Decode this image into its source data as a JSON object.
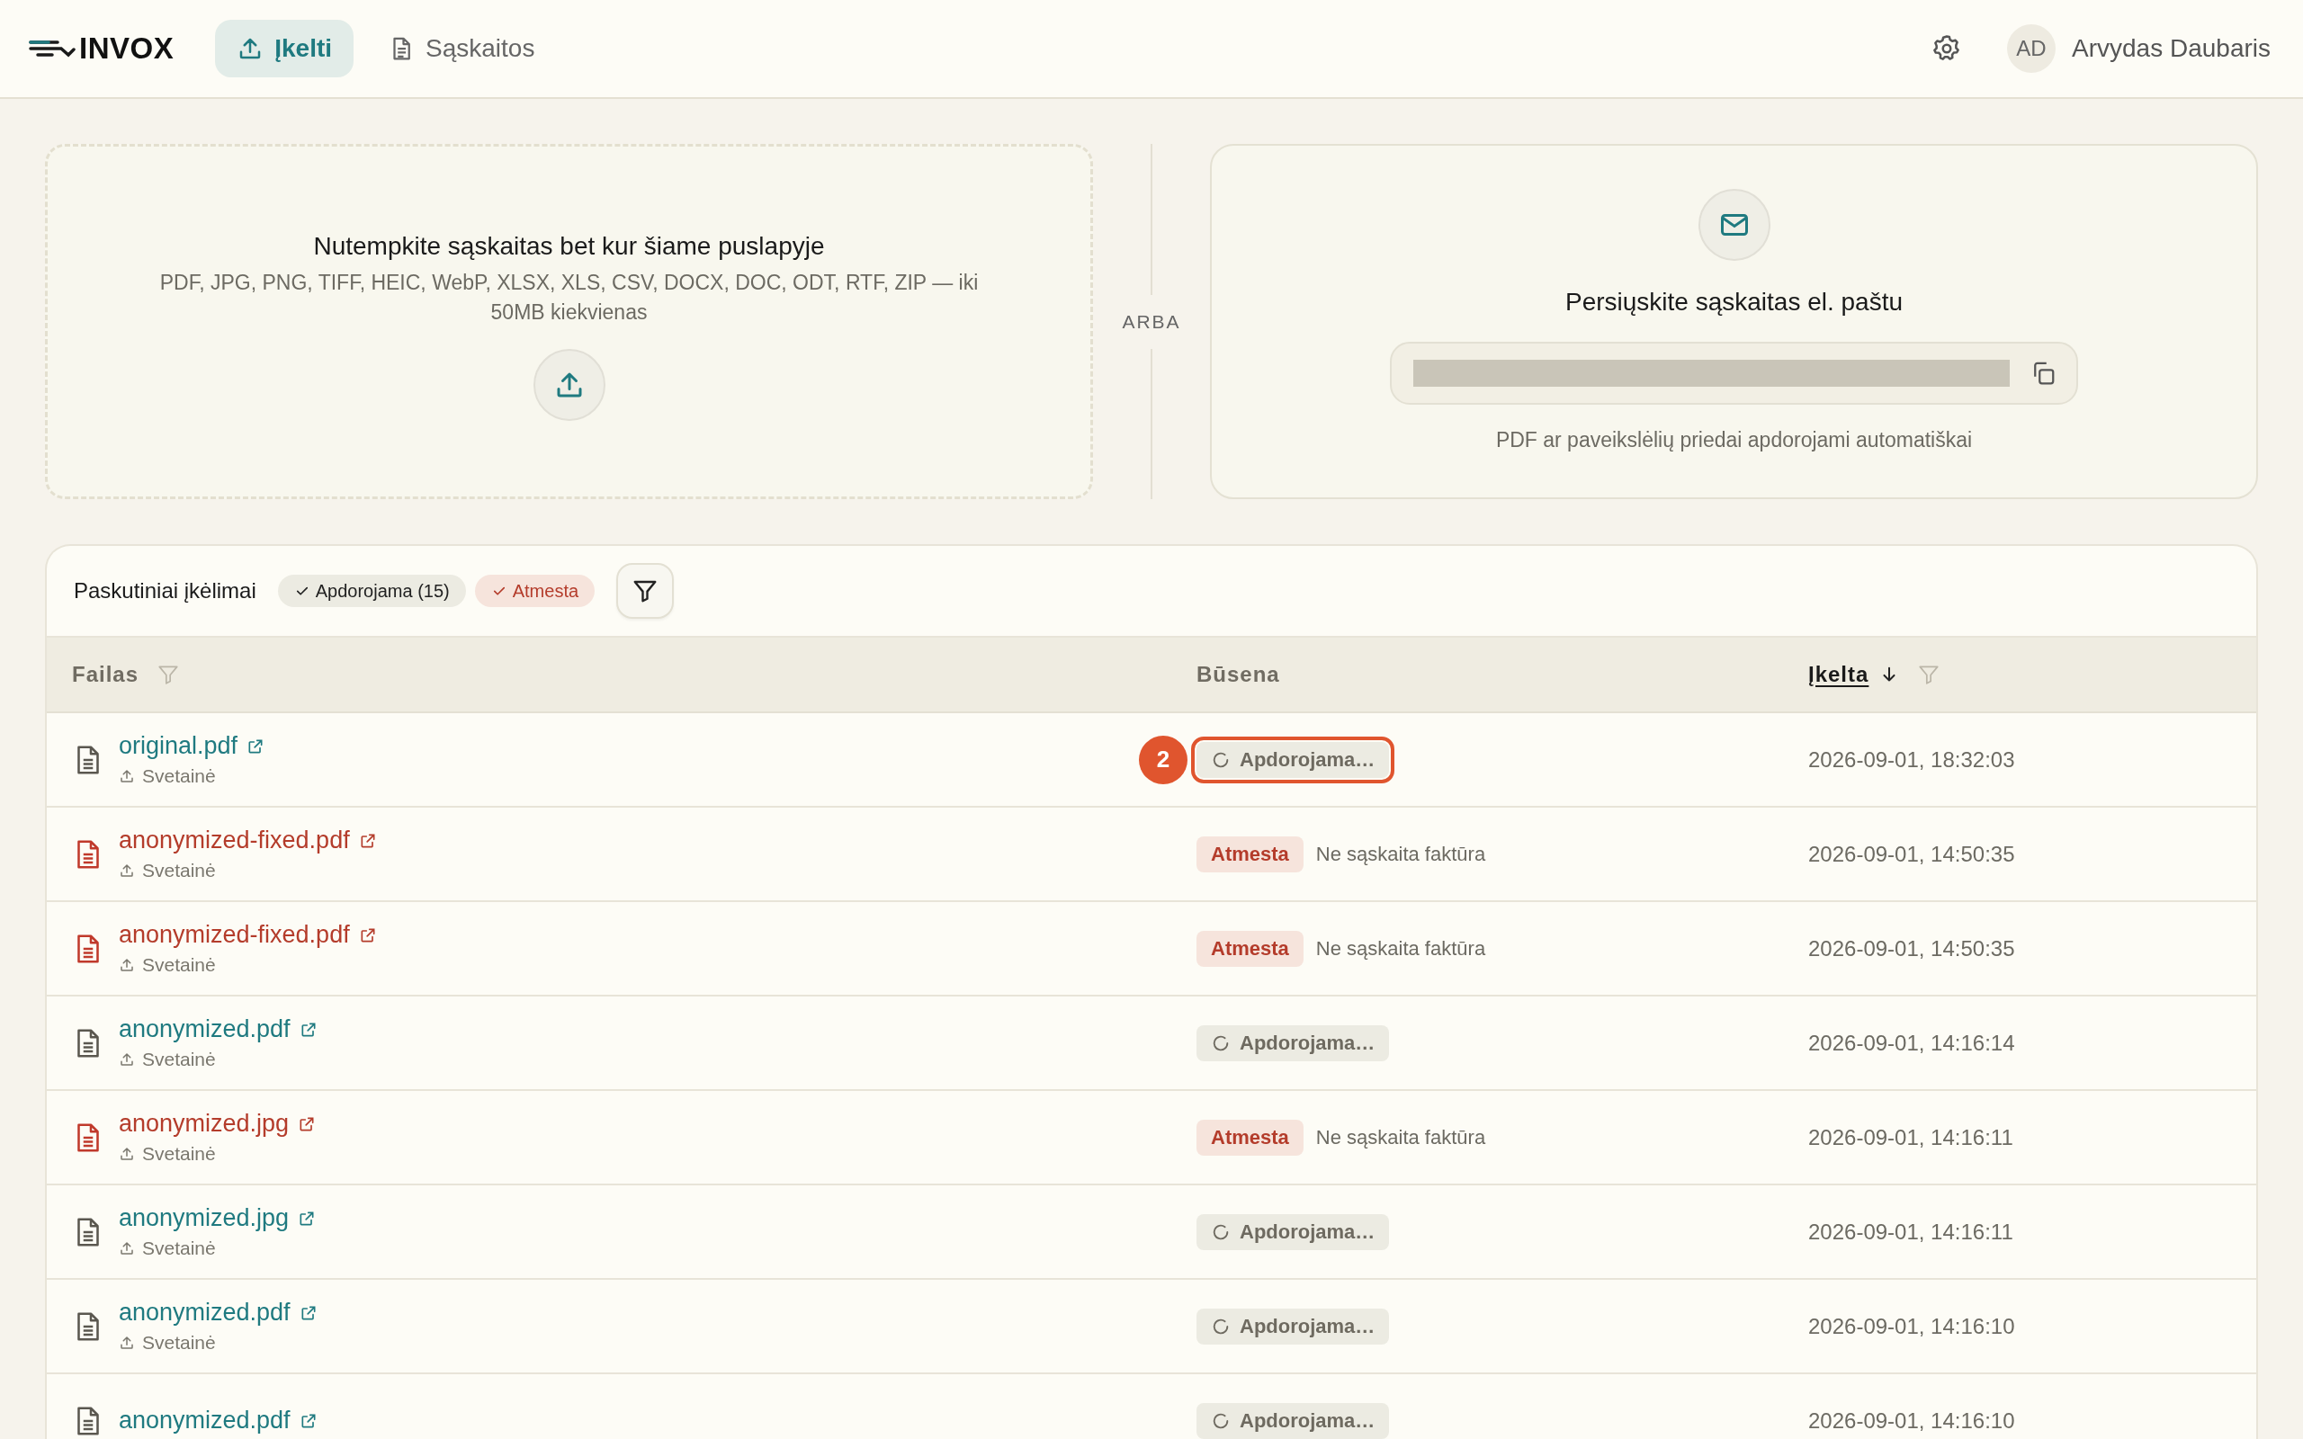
{
  "app": {
    "logo": "INVOX"
  },
  "nav": [
    {
      "label": "Įkelti",
      "selected": true
    },
    {
      "label": "Sąskaitos",
      "selected": false
    }
  ],
  "user": {
    "initials": "AD",
    "name": "Arvydas Daubaris"
  },
  "dropzone": {
    "title": "Nutempkite sąskaitas bet kur šiame puslapyje",
    "formats": "PDF, JPG, PNG, TIFF, HEIC, WebP, XLSX, XLS, CSV, DOCX, DOC, ODT, RTF, ZIP — iki 50MB kiekvienas"
  },
  "divider": "ARBA",
  "email": {
    "title": "Persiųskite sąskaitas el. paštu",
    "note": "PDF ar paveikslėlių priedai apdorojami automatiškai"
  },
  "uploads": {
    "title": "Paskutiniai įkėlimai",
    "filters": [
      {
        "label": "Apdorojama (15)",
        "kind": "neutral",
        "selected": true
      },
      {
        "label": "Atmesta",
        "kind": "danger",
        "selected": true
      }
    ],
    "columns": [
      {
        "label": "Failas",
        "sorted": false,
        "filterable": true
      },
      {
        "label": "Būsena",
        "sorted": false,
        "filterable": false
      },
      {
        "label": "Įkelta",
        "sorted": true,
        "filterable": true
      }
    ],
    "rows": [
      {
        "file": "original.pdf",
        "source": "Svetainė",
        "status": {
          "kind": "processing",
          "label": "Apdorojama…"
        },
        "uploaded": "2026-09-01, 18:32:03",
        "marker": "2"
      },
      {
        "file": "anonymized-fixed.pdf",
        "source": "Svetainė",
        "status": {
          "kind": "rejected",
          "label": "Atmesta",
          "reason": "Ne sąskaita faktūra"
        },
        "uploaded": "2026-09-01, 14:50:35"
      },
      {
        "file": "anonymized-fixed.pdf",
        "source": "Svetainė",
        "status": {
          "kind": "rejected",
          "label": "Atmesta",
          "reason": "Ne sąskaita faktūra"
        },
        "uploaded": "2026-09-01, 14:50:35"
      },
      {
        "file": "anonymized.pdf",
        "source": "Svetainė",
        "status": {
          "kind": "processing",
          "label": "Apdorojama…"
        },
        "uploaded": "2026-09-01, 14:16:14"
      },
      {
        "file": "anonymized.jpg",
        "source": "Svetainė",
        "status": {
          "kind": "rejected",
          "label": "Atmesta",
          "reason": "Ne sąskaita faktūra"
        },
        "uploaded": "2026-09-01, 14:16:11"
      },
      {
        "file": "anonymized.jpg",
        "source": "Svetainė",
        "status": {
          "kind": "processing",
          "label": "Apdorojama…"
        },
        "uploaded": "2026-09-01, 14:16:11"
      },
      {
        "file": "anonymized.pdf",
        "source": "Svetainė",
        "status": {
          "kind": "processing",
          "label": "Apdorojama…"
        },
        "uploaded": "2026-09-01, 14:16:10"
      },
      {
        "file": "anonymized.pdf",
        "status": {
          "kind": "processing",
          "label": "Apdorojama…"
        },
        "uploaded": "2026-09-01, 14:16:10"
      }
    ]
  }
}
